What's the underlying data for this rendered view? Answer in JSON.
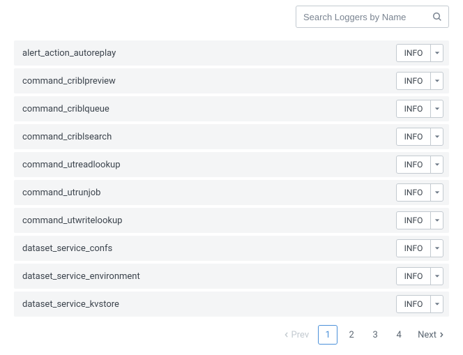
{
  "search": {
    "placeholder": "Search Loggers by Name",
    "value": ""
  },
  "loggers": {
    "items": [
      {
        "name": "alert_action_autoreplay",
        "level": "INFO"
      },
      {
        "name": "command_criblpreview",
        "level": "INFO"
      },
      {
        "name": "command_criblqueue",
        "level": "INFO"
      },
      {
        "name": "command_criblsearch",
        "level": "INFO"
      },
      {
        "name": "command_utreadlookup",
        "level": "INFO"
      },
      {
        "name": "command_utrunjob",
        "level": "INFO"
      },
      {
        "name": "command_utwritelookup",
        "level": "INFO"
      },
      {
        "name": "dataset_service_confs",
        "level": "INFO"
      },
      {
        "name": "dataset_service_environment",
        "level": "INFO"
      },
      {
        "name": "dataset_service_kvstore",
        "level": "INFO"
      }
    ]
  },
  "pagination": {
    "prev_label": "Prev",
    "next_label": "Next",
    "pages": [
      "1",
      "2",
      "3",
      "4"
    ],
    "active_index": 0,
    "prev_disabled": true,
    "next_disabled": false
  }
}
